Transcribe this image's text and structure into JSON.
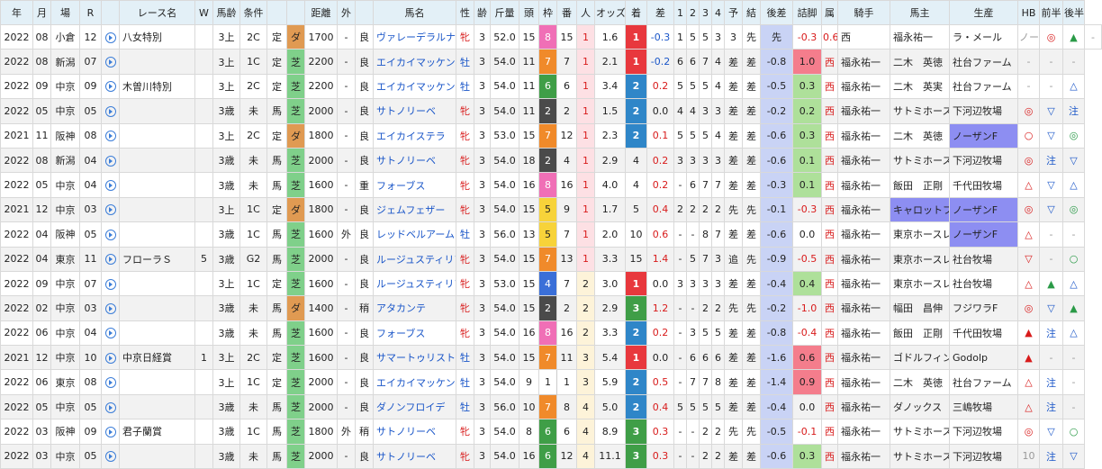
{
  "headers": [
    "年",
    "月",
    "場",
    "R",
    "",
    "レース名",
    "W",
    "馬齢",
    "条件",
    "",
    "",
    "距離",
    "外",
    "",
    "馬名",
    "性",
    "齢",
    "斤量",
    "頭",
    "枠",
    "番",
    "人",
    "オッズ",
    "着",
    "差",
    "1",
    "2",
    "3",
    "4",
    "予",
    "結",
    "後差",
    "詰脚",
    "属",
    "騎手",
    "馬主",
    "生産",
    "HB",
    "前半",
    "後半"
  ],
  "rows": [
    [
      "2022",
      "08",
      "小倉",
      "12",
      "▶",
      "八女特別",
      "",
      "3上",
      "2C",
      "定",
      "ダ",
      "1700",
      "-",
      "良",
      "ヴァレーデラルナ",
      "牝",
      "3",
      "52.0",
      "15",
      "8",
      "15",
      "1",
      "1.6",
      "1",
      "-0.3",
      "1",
      "5",
      "5",
      "3",
      "3",
      "先",
      "先",
      "-0.3",
      "0.6",
      "西",
      "福永祐一",
      "ラ・メール",
      "ノーザンF",
      "◎",
      "▲",
      "-"
    ],
    [
      "2022",
      "08",
      "新潟",
      "07",
      "▶",
      "",
      "",
      "3上",
      "1C",
      "定",
      "芝",
      "2200",
      "-",
      "良",
      "エイカイマッケンロ",
      "牡",
      "3",
      "54.0",
      "11",
      "7",
      "7",
      "1",
      "2.1",
      "1",
      "-0.2",
      "6",
      "6",
      "7",
      "4",
      "差",
      "差",
      "-0.8",
      "1.0",
      "西",
      "福永祐一",
      "二木　英徳",
      "社台ファーム",
      "-",
      "-",
      "-"
    ],
    [
      "2022",
      "09",
      "中京",
      "09",
      "▶",
      "木曽川特別",
      "",
      "3上",
      "2C",
      "定",
      "芝",
      "2200",
      "-",
      "良",
      "エイカイマッケンロ",
      "牡",
      "3",
      "54.0",
      "11",
      "6",
      "6",
      "1",
      "3.4",
      "2",
      "0.2",
      "5",
      "5",
      "5",
      "4",
      "差",
      "差",
      "-0.5",
      "0.3",
      "西",
      "福永祐一",
      "二木　英実",
      "社台ファーム",
      "-",
      "-",
      "△"
    ],
    [
      "2022",
      "05",
      "中京",
      "05",
      "▶",
      "",
      "",
      "3歳",
      "未",
      "馬",
      "芝",
      "2000",
      "-",
      "良",
      "サトノリーベ",
      "牝",
      "3",
      "54.0",
      "11",
      "2",
      "2",
      "1",
      "1.5",
      "2",
      "0.0",
      "4",
      "4",
      "3",
      "3",
      "差",
      "差",
      "-0.2",
      "0.2",
      "西",
      "福永祐一",
      "サトミホース",
      "下河辺牧場",
      "◎",
      "▽",
      "注"
    ],
    [
      "2021",
      "11",
      "阪神",
      "08",
      "▶",
      "",
      "",
      "3上",
      "2C",
      "定",
      "ダ",
      "1800",
      "-",
      "良",
      "エイカイステラ",
      "牝",
      "3",
      "53.0",
      "15",
      "7",
      "12",
      "1",
      "2.3",
      "2",
      "0.1",
      "5",
      "5",
      "5",
      "4",
      "差",
      "差",
      "-0.6",
      "0.3",
      "西",
      "福永祐一",
      "二木　英徳",
      "ノーザンF",
      "○",
      "▽",
      "◎"
    ],
    [
      "2022",
      "08",
      "新潟",
      "04",
      "▶",
      "",
      "",
      "3歳",
      "未",
      "馬",
      "芝",
      "2000",
      "-",
      "良",
      "サトノリーベ",
      "牝",
      "3",
      "54.0",
      "18",
      "2",
      "4",
      "1",
      "2.9",
      "4",
      "0.2",
      "3",
      "3",
      "3",
      "3",
      "差",
      "差",
      "-0.6",
      "0.1",
      "西",
      "福永祐一",
      "サトミホース",
      "下河辺牧場",
      "◎",
      "注",
      "▽"
    ],
    [
      "2022",
      "05",
      "中京",
      "04",
      "▶",
      "",
      "",
      "3歳",
      "未",
      "馬",
      "芝",
      "1600",
      "-",
      "重",
      "フォーブス",
      "牝",
      "3",
      "54.0",
      "16",
      "8",
      "16",
      "1",
      "4.0",
      "4",
      "0.2",
      "-",
      "6",
      "7",
      "7",
      "差",
      "差",
      "-0.3",
      "0.1",
      "西",
      "福永祐一",
      "飯田　正剛",
      "千代田牧場",
      "△",
      "▽",
      "△"
    ],
    [
      "2021",
      "12",
      "中京",
      "03",
      "▶",
      "",
      "",
      "3上",
      "1C",
      "定",
      "ダ",
      "1800",
      "-",
      "良",
      "ジェムフェザー",
      "牝",
      "3",
      "54.0",
      "15",
      "5",
      "9",
      "1",
      "1.7",
      "5",
      "0.4",
      "2",
      "2",
      "2",
      "2",
      "先",
      "先",
      "-0.1",
      "-0.3",
      "西",
      "福永祐一",
      "キャロットフ",
      "ノーザンF",
      "◎",
      "▽",
      "◎"
    ],
    [
      "2022",
      "04",
      "阪神",
      "05",
      "▶",
      "",
      "",
      "3歳",
      "1C",
      "馬",
      "芝",
      "1600",
      "外",
      "良",
      "レッドベルアーム",
      "牡",
      "3",
      "56.0",
      "13",
      "5",
      "7",
      "1",
      "2.0",
      "10",
      "0.6",
      "-",
      "-",
      "8",
      "7",
      "差",
      "差",
      "-0.6",
      "0.0",
      "西",
      "福永祐一",
      "東京ホースレ",
      "ノーザンF",
      "△",
      "-",
      "-"
    ],
    [
      "2022",
      "04",
      "東京",
      "11",
      "▶",
      "フローラＳ",
      "5",
      "3歳",
      "G2",
      "馬",
      "芝",
      "2000",
      "-",
      "良",
      "ルージュスティリア",
      "牝",
      "3",
      "54.0",
      "15",
      "7",
      "13",
      "1",
      "3.3",
      "15",
      "1.4",
      "-",
      "5",
      "7",
      "3",
      "追",
      "先",
      "-0.9",
      "-0.5",
      "西",
      "福永祐一",
      "東京ホースレ",
      "社台牧場",
      "▽",
      "-",
      "○"
    ],
    [
      "2022",
      "09",
      "中京",
      "07",
      "▶",
      "",
      "",
      "3上",
      "1C",
      "定",
      "芝",
      "1600",
      "-",
      "良",
      "ルージュスティリア",
      "牝",
      "3",
      "53.0",
      "15",
      "4",
      "7",
      "2",
      "3.0",
      "1",
      "0.0",
      "3",
      "3",
      "3",
      "3",
      "差",
      "差",
      "-0.4",
      "0.4",
      "西",
      "福永祐一",
      "東京ホースレ",
      "社台牧場",
      "△",
      "▲",
      "△"
    ],
    [
      "2022",
      "02",
      "中京",
      "03",
      "▶",
      "",
      "",
      "3歳",
      "未",
      "馬",
      "ダ",
      "1400",
      "-",
      "稍",
      "アタカンテ",
      "牝",
      "3",
      "54.0",
      "15",
      "2",
      "2",
      "2",
      "2.9",
      "3",
      "1.2",
      "-",
      "-",
      "2",
      "2",
      "先",
      "先",
      "-0.2",
      "-1.0",
      "西",
      "福永祐一",
      "幅田　昌伸",
      "フジワラF",
      "◎",
      "▽",
      "▲"
    ],
    [
      "2022",
      "06",
      "中京",
      "04",
      "▶",
      "",
      "",
      "3歳",
      "未",
      "馬",
      "芝",
      "1600",
      "-",
      "良",
      "フォーブス",
      "牝",
      "3",
      "54.0",
      "16",
      "8",
      "16",
      "2",
      "3.3",
      "2",
      "0.2",
      "-",
      "3",
      "5",
      "5",
      "差",
      "差",
      "-0.8",
      "-0.4",
      "西",
      "福永祐一",
      "飯田　正剛",
      "千代田牧場",
      "▲",
      "注",
      "△"
    ],
    [
      "2021",
      "12",
      "中京",
      "10",
      "▶",
      "中京日経賞",
      "1",
      "3上",
      "2C",
      "定",
      "芝",
      "1600",
      "-",
      "良",
      "サマートゥリスト",
      "牡",
      "3",
      "54.0",
      "15",
      "7",
      "11",
      "3",
      "5.4",
      "1",
      "0.0",
      "-",
      "6",
      "6",
      "6",
      "差",
      "差",
      "-1.6",
      "0.6",
      "西",
      "福永祐一",
      "ゴドルフィン",
      "Godolp",
      "▲",
      "-",
      "-"
    ],
    [
      "2022",
      "06",
      "東京",
      "08",
      "▶",
      "",
      "",
      "3上",
      "1C",
      "定",
      "芝",
      "2000",
      "-",
      "良",
      "エイカイマッケンロ",
      "牡",
      "3",
      "54.0",
      "9",
      "1",
      "1",
      "3",
      "5.9",
      "2",
      "0.5",
      "-",
      "7",
      "7",
      "8",
      "差",
      "差",
      "-1.4",
      "0.9",
      "西",
      "福永祐一",
      "二木　英徳",
      "社台ファーム",
      "△",
      "注",
      "-"
    ],
    [
      "2022",
      "05",
      "中京",
      "05",
      "▶",
      "",
      "",
      "3歳",
      "未",
      "馬",
      "芝",
      "2000",
      "-",
      "良",
      "ダノンフロイデ",
      "牡",
      "3",
      "56.0",
      "10",
      "7",
      "8",
      "4",
      "5.0",
      "2",
      "0.4",
      "5",
      "5",
      "5",
      "5",
      "差",
      "差",
      "-0.4",
      "0.0",
      "西",
      "福永祐一",
      "ダノックス",
      "三嶋牧場",
      "△",
      "注",
      "-"
    ],
    [
      "2022",
      "03",
      "阪神",
      "09",
      "▶",
      "君子蘭賞",
      "",
      "3歳",
      "1C",
      "馬",
      "芝",
      "1800",
      "外",
      "稍",
      "サトノリーベ",
      "牝",
      "3",
      "54.0",
      "8",
      "6",
      "6",
      "4",
      "8.9",
      "3",
      "0.3",
      "-",
      "-",
      "2",
      "2",
      "先",
      "先",
      "-0.5",
      "-0.1",
      "西",
      "福永祐一",
      "サトミホース",
      "下河辺牧場",
      "◎",
      "▽",
      "○"
    ],
    [
      "2022",
      "03",
      "中京",
      "05",
      "▶",
      "",
      "",
      "3歳",
      "未",
      "馬",
      "芝",
      "2000",
      "-",
      "良",
      "サトノリーベ",
      "牝",
      "3",
      "54.0",
      "16",
      "6",
      "12",
      "4",
      "11.1",
      "3",
      "0.3",
      "-",
      "-",
      "2",
      "2",
      "差",
      "差",
      "-0.6",
      "0.3",
      "西",
      "福永祐一",
      "サトミホース",
      "下河辺牧場",
      "10",
      "注",
      "▽"
    ]
  ]
}
